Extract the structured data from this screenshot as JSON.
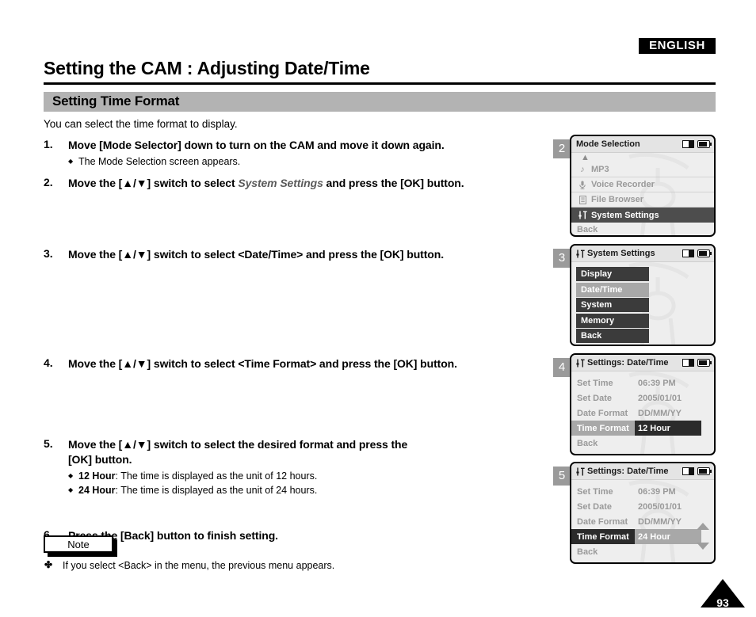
{
  "header": {
    "language_badge": "ENGLISH",
    "page_title": "Setting the CAM : Adjusting Date/Time",
    "section_title": "Setting Time Format",
    "intro": "You can select the time format to display."
  },
  "steps": [
    {
      "num": "1.",
      "text": "Move [Mode Selector] down to turn on the CAM and move it down again.",
      "bullets": [
        "The Mode Selection screen appears."
      ]
    },
    {
      "num": "2.",
      "text_pre": "Move the [▲/▼] switch to select ",
      "text_italic": "System Settings",
      "text_post": " and press the [OK] button."
    },
    {
      "num": "3.",
      "text": "Move the [▲/▼] switch to select <Date/Time> and press the [OK] button."
    },
    {
      "num": "4.",
      "text": "Move the [▲/▼] switch to select <Time Format> and press the [OK] button."
    },
    {
      "num": "5.",
      "text": "Move the [▲/▼] switch to select the desired format and press the [OK] button.",
      "bullets_rich": [
        {
          "bold": "12 Hour",
          "rest": ": The time is displayed as the unit of 12 hours."
        },
        {
          "bold": "24 Hour",
          "rest": ": The time is displayed as the unit of 24 hours."
        }
      ]
    },
    {
      "num": "6.",
      "text": "Press the [Back] button to finish setting."
    }
  ],
  "note": {
    "label": "Note",
    "items": [
      "If you select <Back> in the menu, the previous menu appears."
    ]
  },
  "footer": {
    "page_number": "93"
  },
  "panels": [
    {
      "badge": "2",
      "title": "Mode Selection",
      "title_icon": "none",
      "status_icons": [
        "memory-card-icon",
        "battery-icon"
      ],
      "type": "mode-list",
      "scroll_up": true,
      "items": [
        {
          "icon": "music-note-icon",
          "label": "MP3",
          "selected": false
        },
        {
          "icon": "microphone-icon",
          "label": "Voice Recorder",
          "selected": false
        },
        {
          "icon": "file-browser-icon",
          "label": "File Browser",
          "selected": false
        },
        {
          "icon": "settings-slider-icon",
          "label": "System Settings",
          "selected": true
        },
        {
          "icon": "none",
          "label": "Back",
          "selected": false
        }
      ]
    },
    {
      "badge": "3",
      "title": "System Settings",
      "title_icon": "settings-slider-icon",
      "status_icons": [
        "memory-card-icon",
        "battery-icon"
      ],
      "type": "block-list",
      "items": [
        {
          "label": "Display",
          "selected": false
        },
        {
          "label": "Date/Time",
          "selected": true
        },
        {
          "label": "System",
          "selected": false
        },
        {
          "label": "Memory",
          "selected": false
        },
        {
          "label": "Back",
          "selected": false
        }
      ]
    },
    {
      "badge": "4",
      "title": "Settings: Date/Time",
      "title_icon": "settings-slider-icon",
      "status_icons": [
        "memory-card-icon",
        "battery-icon"
      ],
      "type": "kv-list",
      "scroll_arrows": false,
      "rows": [
        {
          "label": "Set Time",
          "value": "06:39 PM",
          "state": "normal"
        },
        {
          "label": "Set Date",
          "value": "2005/01/01",
          "state": "normal"
        },
        {
          "label": "Date Format",
          "value": "DD/MM/YY",
          "state": "normal"
        },
        {
          "label": "Time Format",
          "value": "12 Hour",
          "state": "sel-label"
        },
        {
          "label": "Back",
          "value": "",
          "state": "normal"
        }
      ]
    },
    {
      "badge": "5",
      "title": "Settings: Date/Time",
      "title_icon": "settings-slider-icon",
      "status_icons": [
        "memory-card-icon",
        "battery-icon"
      ],
      "type": "kv-list",
      "scroll_arrows": true,
      "rows": [
        {
          "label": "Set Time",
          "value": "06:39 PM",
          "state": "normal"
        },
        {
          "label": "Set Date",
          "value": "2005/01/01",
          "state": "normal"
        },
        {
          "label": "Date Format",
          "value": "DD/MM/YY",
          "state": "normal"
        },
        {
          "label": "Time Format",
          "value": "24 Hour",
          "state": "sel-value"
        },
        {
          "label": "Back",
          "value": "",
          "state": "normal"
        }
      ]
    }
  ],
  "colors": {
    "section_bar": "#b3b3b3",
    "badge_gray": "#9a9a9a",
    "lcd_bg": "#eeeeee",
    "selected_dark": "#3b3b3b",
    "selected_gray": "#a8a8a8"
  }
}
